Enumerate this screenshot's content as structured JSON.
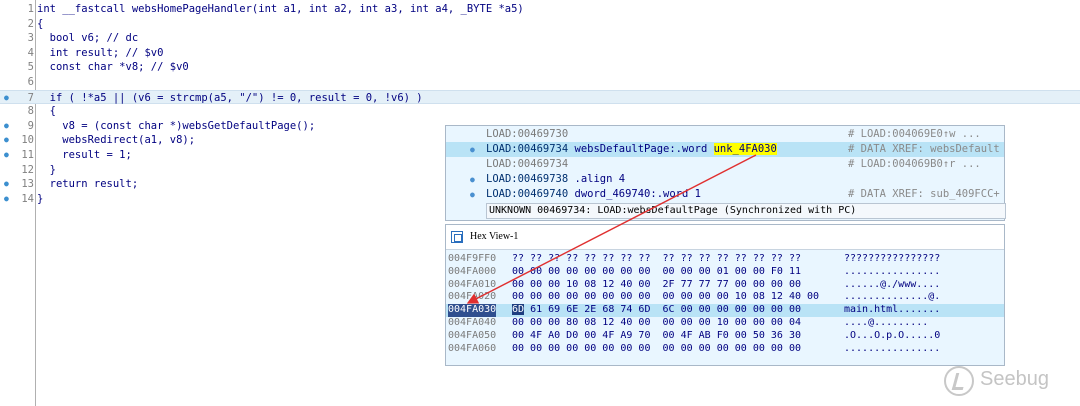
{
  "pseudocode": {
    "lines": [
      {
        "num": "1",
        "text": "int __fastcall websHomePageHandler(int a1, int a2, int a3, int a4, _BYTE *a5)",
        "dot": false
      },
      {
        "num": "2",
        "text": "{",
        "dot": false
      },
      {
        "num": "3",
        "text": "  bool v6; // dc",
        "dot": false
      },
      {
        "num": "4",
        "text": "  int result; // $v0",
        "dot": false
      },
      {
        "num": "5",
        "text": "  const char *v8; // $v0",
        "dot": false
      },
      {
        "num": "6",
        "text": "",
        "dot": false
      },
      {
        "num": "7",
        "text": "  if ( !*a5 || (v6 = strcmp(a5, \"/\") != 0, result = 0, !v6) )",
        "dot": true
      },
      {
        "num": "8",
        "text": "  {",
        "dot": false
      },
      {
        "num": "9",
        "text": "    v8 = (const char *)websGetDefaultPage();",
        "dot": true
      },
      {
        "num": "10",
        "text": "    websRedirect(a1, v8);",
        "dot": true
      },
      {
        "num": "11",
        "text": "    result = 1;",
        "dot": true
      },
      {
        "num": "12",
        "text": "  }",
        "dot": false
      },
      {
        "num": "13",
        "text": "  return result;",
        "dot": true
      },
      {
        "num": "14",
        "text": "}",
        "dot": true
      }
    ],
    "highlight_line": "7"
  },
  "disasm": {
    "lines": [
      {
        "addr": "LOAD:00469730",
        "text": "",
        "comment": "# LOAD:004069E0↑w ...",
        "dot": false
      },
      {
        "addr": "LOAD:00469734",
        "text": " websDefaultPage:.word ",
        "target": "unk_4FA030",
        "comment": "# DATA XREF: websDefault",
        "dot": true
      },
      {
        "addr": "LOAD:00469734",
        "text": "",
        "comment": "# LOAD:004069B0↑r ...",
        "dot": false
      },
      {
        "addr": "LOAD:00469738",
        "text": " .align 4",
        "comment": "",
        "dot": true
      },
      {
        "addr": "LOAD:00469740",
        "text": " dword_469740:.word 1",
        "comment": "# DATA XREF: sub_409FCC+",
        "dot": true
      }
    ],
    "status": "UNKNOWN 00469734: LOAD:websDefaultPage (Synchronized with PC)"
  },
  "hexview": {
    "title": "Hex View-1",
    "rows": [
      {
        "addr": "004F9FF0",
        "bytes": "?? ?? ?? ?? ?? ?? ?? ??  ?? ?? ?? ?? ?? ?? ?? ??",
        "ascii": "????????????????"
      },
      {
        "addr": "004FA000",
        "bytes": "00 00 00 00 00 00 00 00  00 00 00 01 00 00 F0 11",
        "ascii": "................"
      },
      {
        "addr": "004FA010",
        "bytes": "00 00 00 10 08 12 40 00  2F 77 77 77 00 00 00 00",
        "ascii": "......@./www...."
      },
      {
        "addr": "004FA020",
        "bytes": "00 00 00 00 00 00 00 00  00 00 00 00 10 08 12 40 00",
        "ascii": "..............@."
      },
      {
        "addr": "004FA030",
        "bytes": " 61 69 6E 2E 68 74 6D  6C 00 00 00 00 00 00 00",
        "cursor_byte": "6D",
        "ascii": "main.html......."
      },
      {
        "addr": "004FA040",
        "bytes": "00 00 00 80 08 12 40 00  00 00 00 10 00 00 00 04",
        "ascii": "....@........."
      },
      {
        "addr": "004FA050",
        "bytes": "00 4F A0 D0 00 4F A9 70  00 4F AB F0 00 50 36 30",
        "ascii": ".O...O.p.O.....0"
      },
      {
        "addr": "004FA060",
        "bytes": "00 00 00 00 00 00 00 00  00 00 00 00 00 00 00 00",
        "ascii": "................"
      }
    ],
    "selected_row": "004FA030"
  },
  "watermark": {
    "text": "Seebug"
  },
  "colors": {
    "arrow": "#e03030",
    "highlight": "#e4f0f8",
    "string": "#008000",
    "comment": "#4060c0"
  }
}
